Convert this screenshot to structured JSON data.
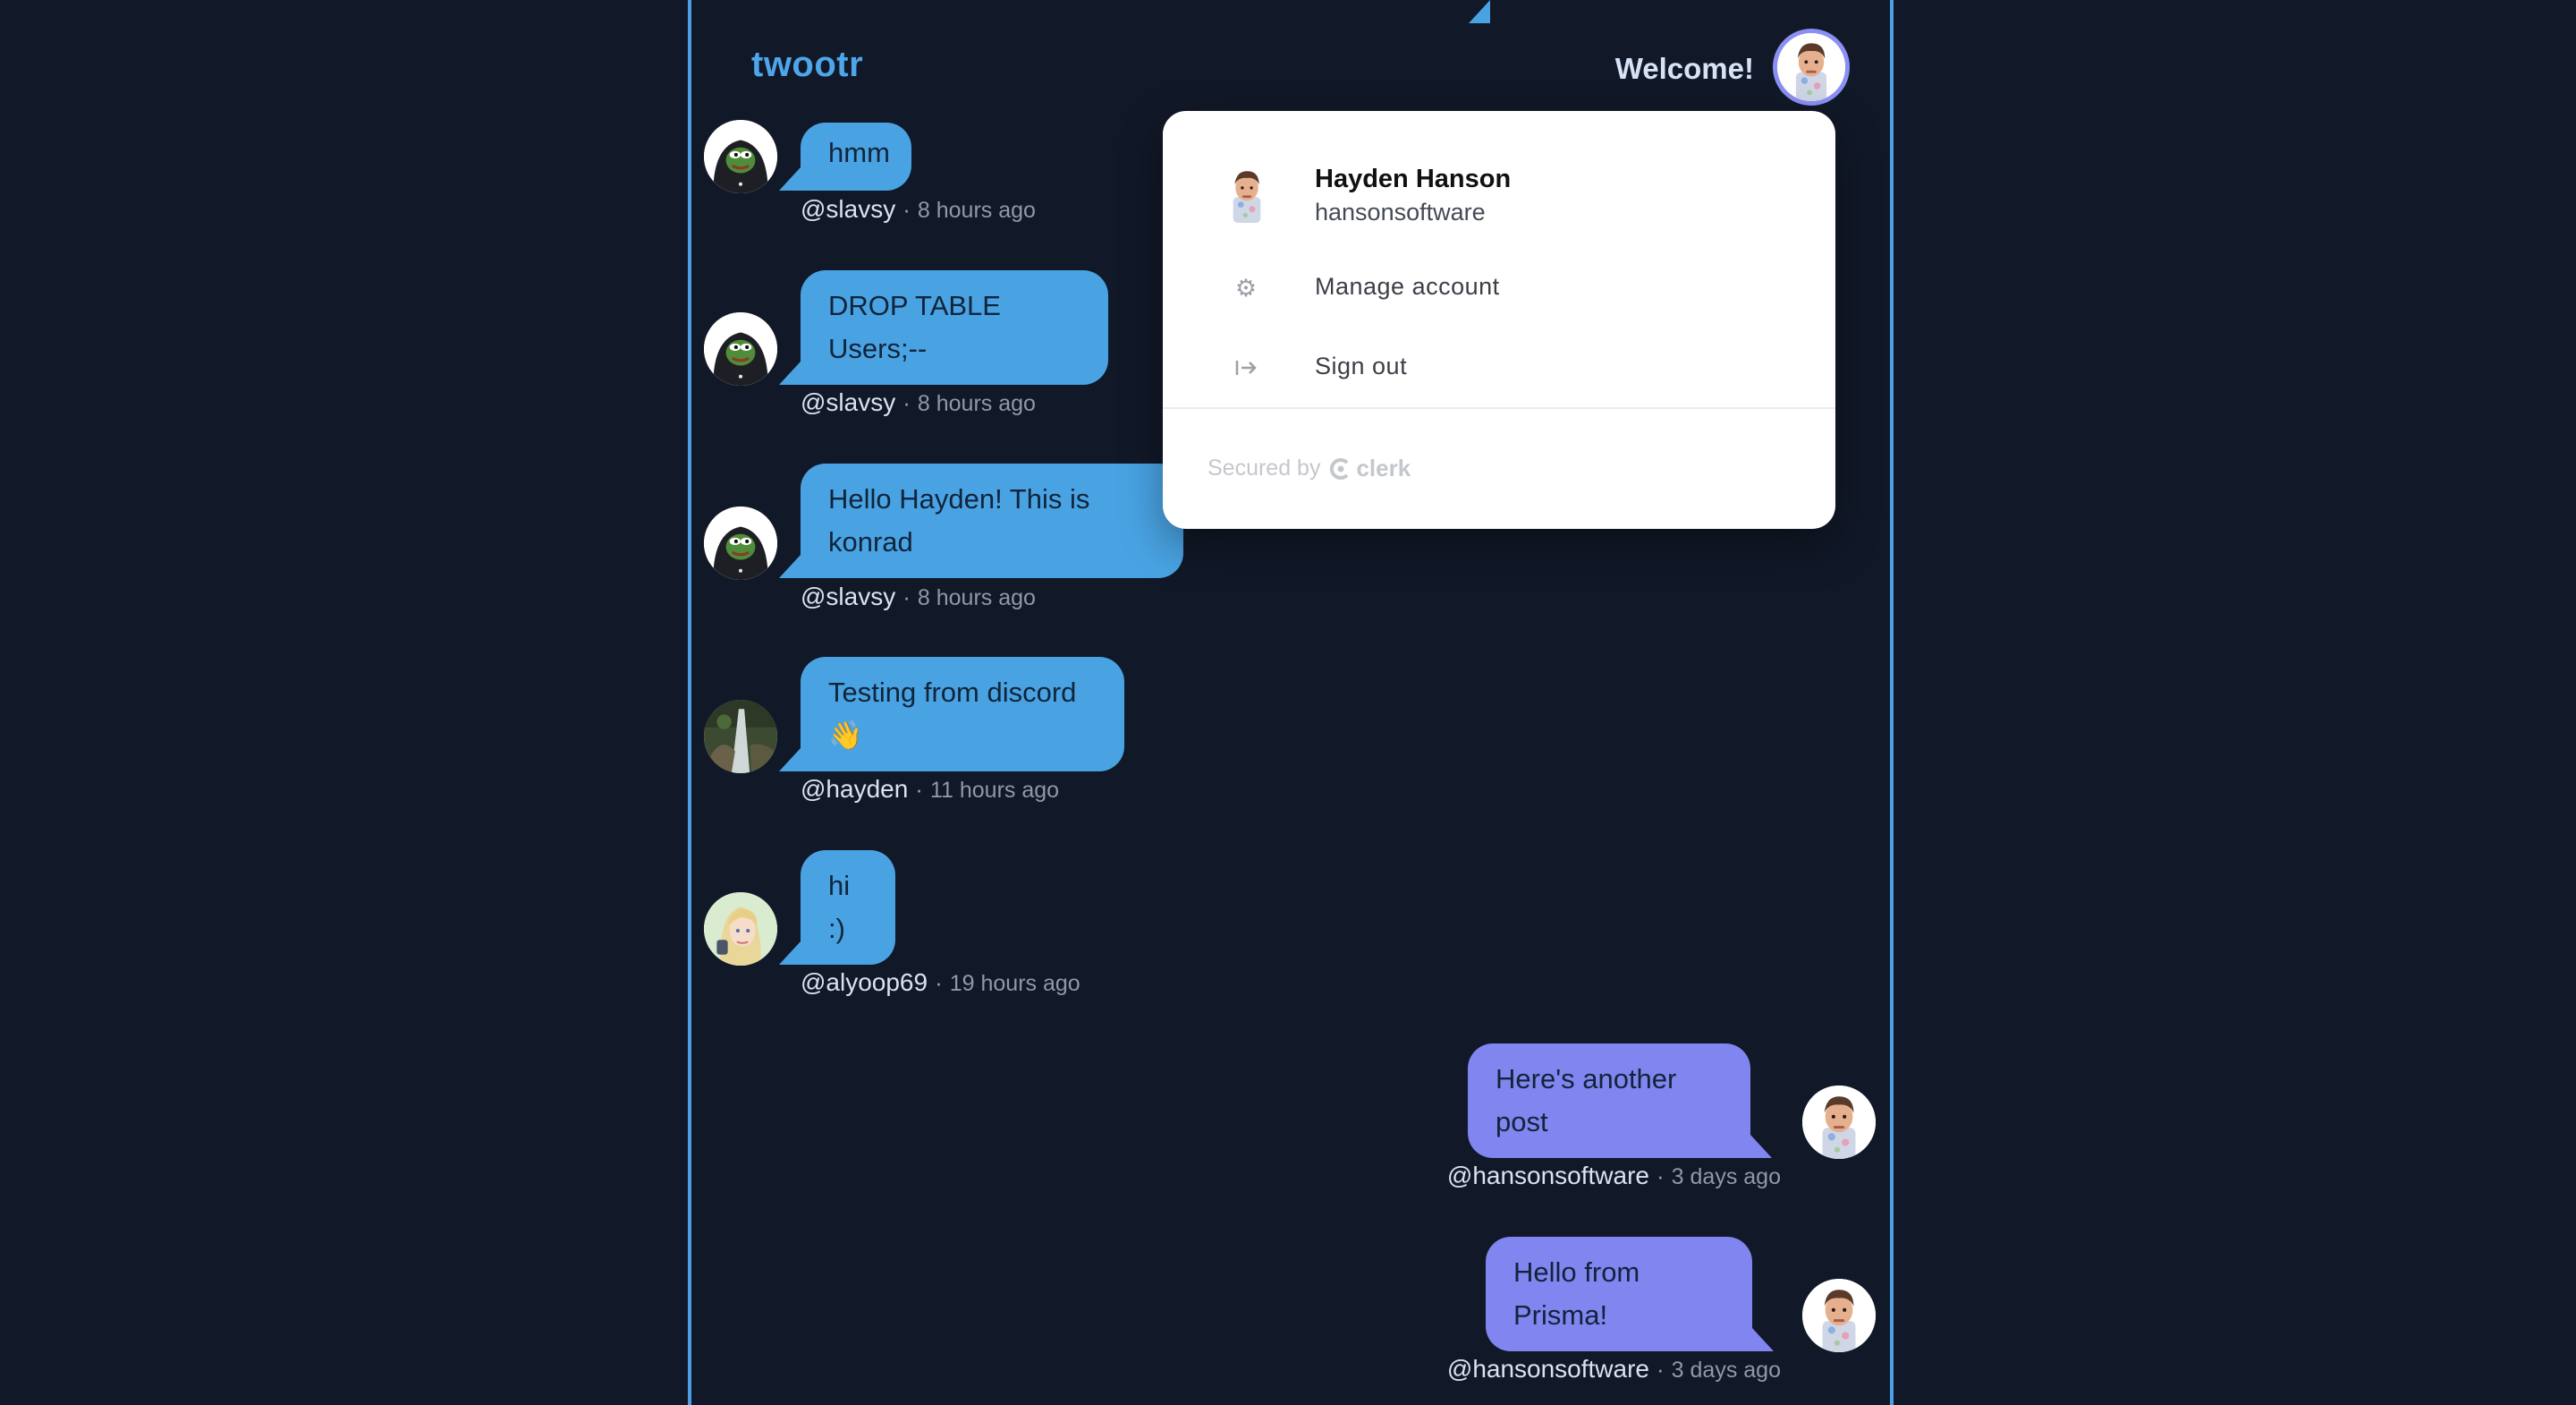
{
  "header": {
    "brand": "twootr",
    "welcome": "Welcome!"
  },
  "user_menu": {
    "name": "Hayden Hanson",
    "username": "hansonsoftware",
    "manage_account": "Manage account",
    "sign_out": "Sign out",
    "secured_by": "Secured by",
    "clerk": "clerk"
  },
  "messages": [
    {
      "text": "hmm",
      "handle": "@slavsy",
      "sep": "·",
      "time": "8 hours ago"
    },
    {
      "text_line1": "DROP TABLE",
      "text_line2": "Users;--",
      "handle": "@slavsy",
      "sep": "·",
      "time": "8 hours ago"
    },
    {
      "text_line1": "Hello Hayden! This is",
      "text_line2": "konrad",
      "handle": "@slavsy",
      "sep": "·",
      "time": "8 hours ago"
    },
    {
      "text_line1": "Testing from discord",
      "text_line2": "👋",
      "handle": "@hayden",
      "sep": "·",
      "time": "11 hours ago"
    },
    {
      "text_line1": "hi",
      "text_line2": ":)",
      "handle": "@alyoop69",
      "sep": "·",
      "time": "19 hours ago"
    },
    {
      "text_line1": "Here's another",
      "text_line2": "post",
      "handle": "@hansonsoftware",
      "sep": "·",
      "time": "3 days ago"
    },
    {
      "text_line1": "Hello from",
      "text_line2": "Prisma!",
      "handle": "@hansonsoftware",
      "sep": "·",
      "time": "3 days ago"
    }
  ],
  "colors": {
    "background": "#111827",
    "border": "#4c9fe6",
    "incoming_bubble": "#49a3e3",
    "outgoing_bubble": "#8185ef",
    "brand": "#4ea5e9"
  }
}
